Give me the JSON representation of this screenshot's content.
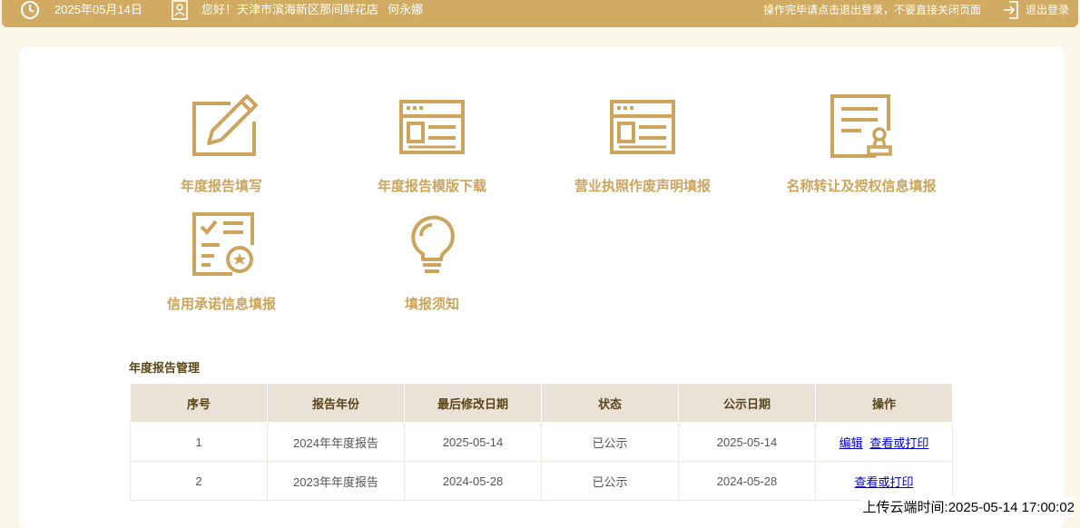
{
  "header": {
    "date": "2025年05月14日",
    "greeting": "您好！天津市滨海新区那间鲜花店",
    "user_name": "何永娜",
    "notice": "操作完毕请点击退出登录，不要直接关闭页面",
    "logout_label": "退出登录",
    "icons": [
      "clock-icon",
      "user-badge-icon",
      "logout-icon"
    ]
  },
  "menu": {
    "items": [
      {
        "label": "年度报告填写",
        "icon": "edit-pencil-icon"
      },
      {
        "label": "年度报告模版下载",
        "icon": "template-window-icon"
      },
      {
        "label": "营业执照作废声明填报",
        "icon": "license-window-icon"
      },
      {
        "label": "名称转让及授权信息填报",
        "icon": "document-stamp-icon"
      },
      {
        "label": "信用承诺信息填报",
        "icon": "checklist-badge-icon"
      },
      {
        "label": "填报须知",
        "icon": "lightbulb-icon"
      }
    ]
  },
  "reports": {
    "title": "年度报告管理",
    "columns": [
      "序号",
      "报告年份",
      "最后修改日期",
      "状态",
      "公示日期",
      "操作"
    ],
    "rows": [
      {
        "index": "1",
        "year": "2024年年度报告",
        "modified": "2025-05-14",
        "status": "已公示",
        "published": "2025-05-14",
        "actions": [
          "编辑",
          "查看或打印"
        ]
      },
      {
        "index": "2",
        "year": "2023年年度报告",
        "modified": "2024-05-28",
        "status": "已公示",
        "published": "2024-05-28",
        "actions": [
          "查看或打印"
        ]
      }
    ]
  },
  "footer": {
    "upload_time": "上传云端时间:2025-05-14 17:00:02"
  },
  "colors": {
    "accent": "#d2ab62",
    "icon_gold": "#cca45c",
    "table_header_bg": "#eae2d7",
    "link": "#0000cc"
  }
}
